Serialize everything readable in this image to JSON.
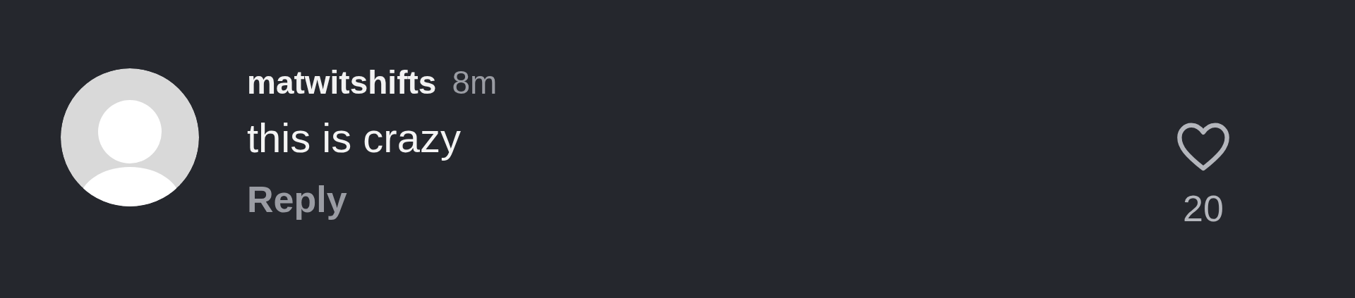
{
  "comment": {
    "author": "matwitshifts",
    "time": "8m",
    "text": "this is crazy",
    "reply": "Reply",
    "liked": false,
    "likes": "20"
  }
}
